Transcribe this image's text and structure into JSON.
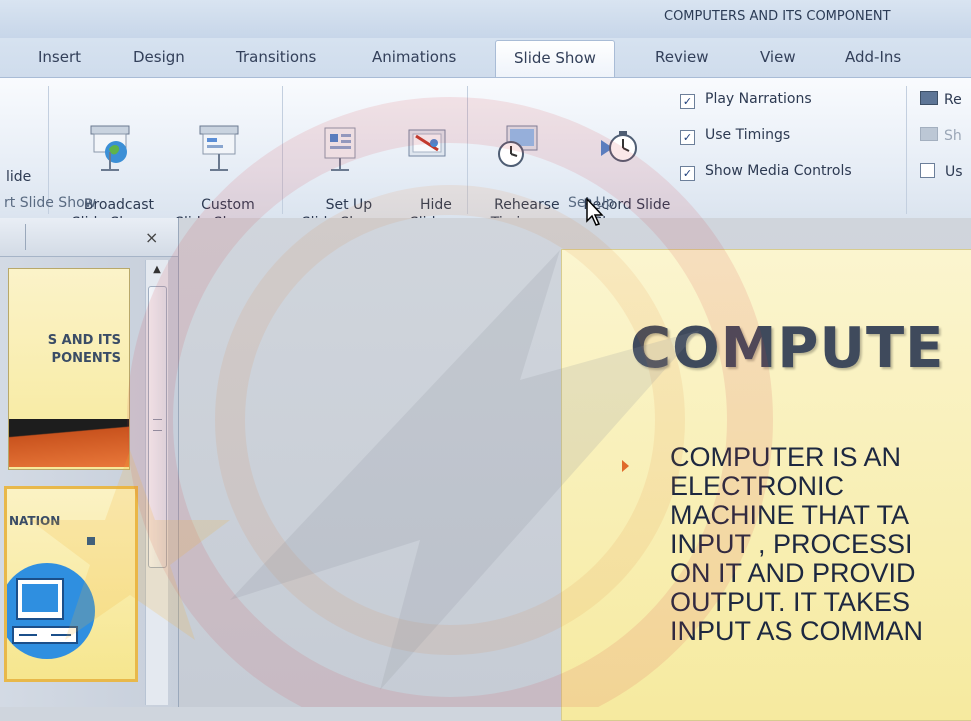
{
  "app": {
    "window_title": "COMPUTERS AND ITS COMPONENT"
  },
  "tabs": [
    {
      "label": "Insert",
      "active": false
    },
    {
      "label": "Design",
      "active": false
    },
    {
      "label": "Transitions",
      "active": false
    },
    {
      "label": "Animations",
      "active": false
    },
    {
      "label": "Slide Show",
      "active": true
    },
    {
      "label": "Review",
      "active": false
    },
    {
      "label": "View",
      "active": false
    },
    {
      "label": "Add-Ins",
      "active": false
    }
  ],
  "ribbon": {
    "start_group": {
      "partial_button_label": "lide",
      "broadcast": "Broadcast\nSlide Show",
      "custom": "Custom\nSlide Show ▾",
      "label": "rt Slide Show"
    },
    "setup_group": {
      "setup": "Set Up\nSlide Show",
      "hide": "Hide\nSlide",
      "rehearse": "Rehearse\nTimings",
      "record": "Record Slide\nShow ▾",
      "label": "Set Up",
      "checkboxes": [
        {
          "label": "Play Narrations",
          "checked": true
        },
        {
          "label": "Use Timings",
          "checked": true
        },
        {
          "label": "Show Media Controls",
          "checked": true
        }
      ]
    },
    "monitors_group": {
      "item1": "Re",
      "item2": "Sh",
      "item3": "Us"
    }
  },
  "slides_pane": {
    "close": "×",
    "thumb1_title": "S AND ITS\nPONENTS",
    "thumb2_title": "NATION"
  },
  "slide": {
    "title": "COMPUTE",
    "bullet_lines": [
      "COMPUTER  IS AN",
      "ELECTRONIC",
      "MACHINE  THAT  TA",
      "INPUT  , PROCESSI",
      "ON IT AND  PROVID",
      "OUTPUT.  IT TAKES",
      "INPUT AS COMMAN"
    ]
  },
  "colors": {
    "ribbon_bg": "#e5ecf5",
    "slide_bg": "#f6ea9f",
    "accent_orange": "#e06a2a",
    "watermark_red": "#d9363e"
  }
}
